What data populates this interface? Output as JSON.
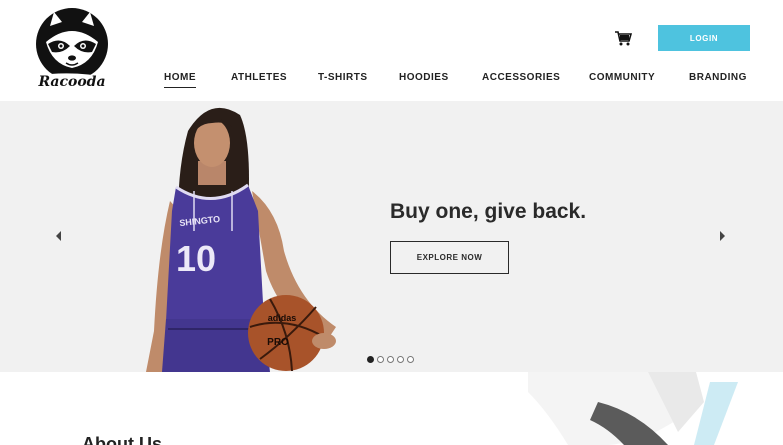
{
  "brand": {
    "logo_text": "Racooda"
  },
  "header": {
    "cart_icon": "cart-icon",
    "login_label": "LOGIN",
    "accent_color": "#4ec3df"
  },
  "nav": {
    "items": [
      {
        "label": "HOME",
        "active": true
      },
      {
        "label": "ATHLETES",
        "active": false
      },
      {
        "label": "T-SHIRTS",
        "active": false
      },
      {
        "label": "HOODIES",
        "active": false
      },
      {
        "label": "ACCESSORIES",
        "active": false
      },
      {
        "label": "COMMUNITY",
        "active": false
      },
      {
        "label": "BRANDING",
        "active": false
      }
    ]
  },
  "hero": {
    "headline": "Buy one, give back.",
    "cta_label": "EXPLORE NOW",
    "jersey_text": "SHINGTO",
    "jersey_number": "10",
    "ball_brand": "adidas",
    "ball_model": "PRO",
    "prev_icon": "chevron-left-icon",
    "next_icon": "chevron-right-icon",
    "slide_count": 5,
    "active_slide": 1
  },
  "about": {
    "title": "About Us"
  }
}
